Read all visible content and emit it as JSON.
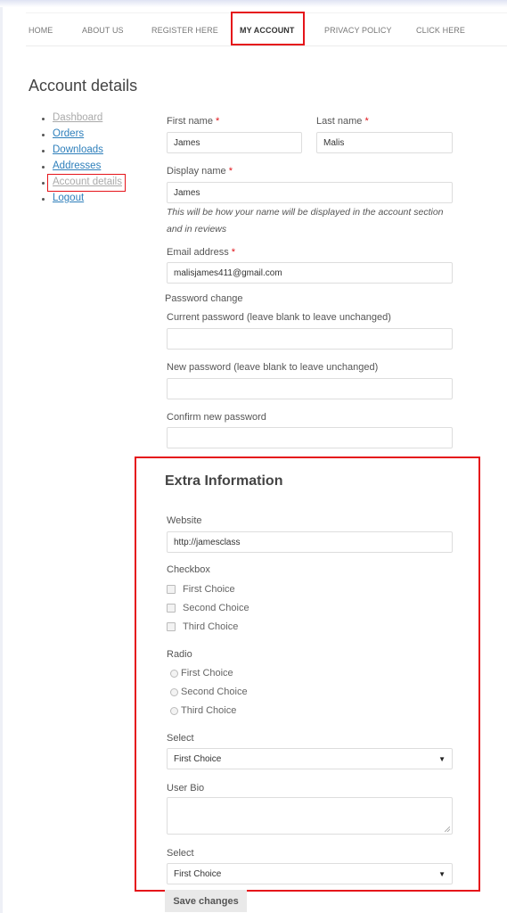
{
  "nav": {
    "items": [
      {
        "label": "HOME",
        "active": false
      },
      {
        "label": "ABOUT US",
        "active": false
      },
      {
        "label": "REGISTER HERE",
        "active": false
      },
      {
        "label": "MY ACCOUNT",
        "active": true
      },
      {
        "label": "PRIVACY POLICY",
        "active": false
      },
      {
        "label": "CLICK HERE",
        "active": false
      }
    ]
  },
  "page_title": "Account details",
  "sidebar": {
    "items": [
      {
        "label": "Dashboard"
      },
      {
        "label": "Orders"
      },
      {
        "label": "Downloads"
      },
      {
        "label": "Addresses"
      },
      {
        "label": "Account details",
        "current": true
      },
      {
        "label": "Logout"
      }
    ]
  },
  "form": {
    "first_name": {
      "label": "First name",
      "required": "*",
      "value": "James"
    },
    "last_name": {
      "label": "Last name",
      "required": "*",
      "value": "Malis"
    },
    "display_name": {
      "label": "Display name",
      "required": "*",
      "value": "James",
      "hint": "This will be how your name will be displayed in the account section and in reviews"
    },
    "email": {
      "label": "Email address",
      "required": "*",
      "value": "malisjames411@gmail.com"
    },
    "password_change": "Password change",
    "current_password": {
      "label": "Current password (leave blank to leave unchanged)",
      "value": ""
    },
    "new_password": {
      "label": "New password (leave blank to leave unchanged)",
      "value": ""
    },
    "confirm_password": {
      "label": "Confirm new password",
      "value": ""
    }
  },
  "extra": {
    "title": "Extra Information",
    "website": {
      "label": "Website",
      "value": "http://jamesclass"
    },
    "checkbox": {
      "label": "Checkbox",
      "options": [
        "First Choice",
        "Second Choice",
        "Third Choice"
      ]
    },
    "radio": {
      "label": "Radio",
      "options": [
        "First Choice",
        "Second Choice",
        "Third Choice"
      ]
    },
    "select1": {
      "label": "Select",
      "value": "First Choice"
    },
    "bio": {
      "label": "User Bio",
      "value": ""
    },
    "select2": {
      "label": "Select",
      "value": "First Choice"
    }
  },
  "save_label": "Save changes",
  "colors": {
    "highlight": "#e5141a",
    "link": "#2e7fbb",
    "required": "#e0141a"
  }
}
